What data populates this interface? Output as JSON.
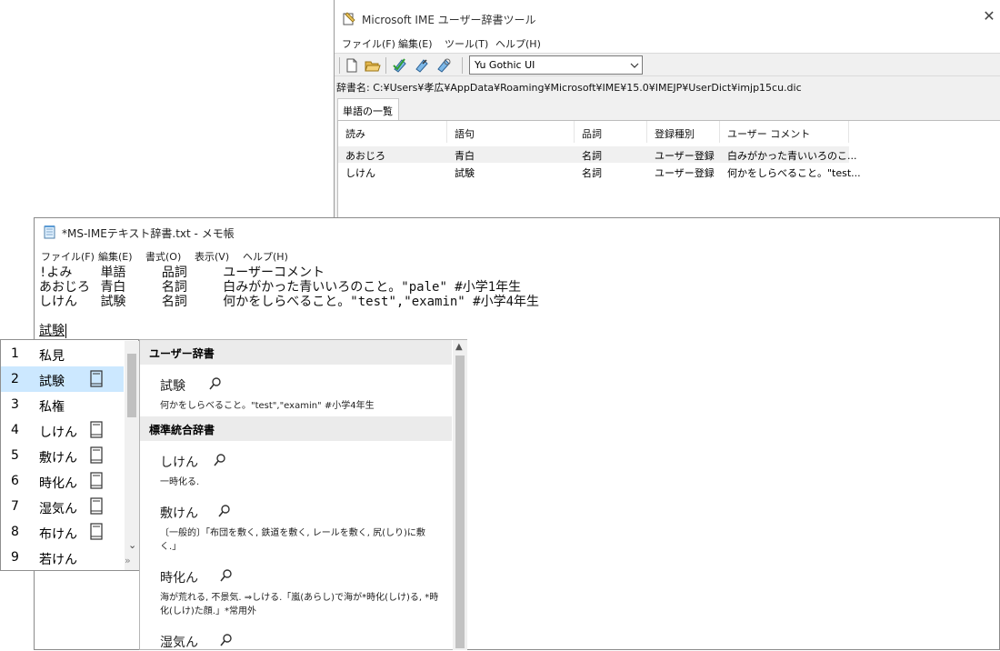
{
  "ime_tool": {
    "title": "Microsoft IME ユーザー辞書ツール",
    "menu": [
      "ファイル(F)",
      "編集(E)",
      "ツール(T)",
      "ヘルプ(H)"
    ],
    "font_select": "Yu Gothic UI",
    "dict_path": "辞書名: C:¥Users¥孝広¥AppData¥Roaming¥Microsoft¥IME¥15.0¥IMEJP¥UserDict¥imjp15cu.dic",
    "tab_label": "単語の一覧",
    "columns": [
      "読み",
      "語句",
      "品詞",
      "登録種別",
      "ユーザー コメント"
    ],
    "rows": [
      [
        "あおじろ",
        "青白",
        "名詞",
        "ユーザー登録",
        "白みがかった青いいろのこ..."
      ],
      [
        "しけん",
        "試験",
        "名詞",
        "ユーザー登録",
        "何かをしらべること。\"test..."
      ]
    ]
  },
  "notepad": {
    "title": "*MS-IMEテキスト辞書.txt - メモ帳",
    "menu": [
      "ファイル(F)",
      "編集(E)",
      "書式(O)",
      "表示(V)",
      "ヘルプ(H)"
    ],
    "lines": [
      "!よみ\t単語\t品詞\tユーザーコメント",
      "あおじろ\t青白\t名詞\t白みがかった青いいろのこと。\"pale\" #小学1年生",
      "しけん\t試験\t名詞\t何かをしらべること。\"test\",\"examin\" #小学4年生"
    ],
    "composing": "試験"
  },
  "candidates": [
    {
      "num": "1",
      "word": "私見",
      "book": false
    },
    {
      "num": "2",
      "word": "試験",
      "book": true,
      "selected": true
    },
    {
      "num": "3",
      "word": "私権",
      "book": false
    },
    {
      "num": "4",
      "word": "しけん",
      "book": true
    },
    {
      "num": "5",
      "word": "敷けん",
      "book": true
    },
    {
      "num": "6",
      "word": "時化ん",
      "book": true
    },
    {
      "num": "7",
      "word": "湿気ん",
      "book": true
    },
    {
      "num": "8",
      "word": "布けん",
      "book": true
    },
    {
      "num": "9",
      "word": "若けん",
      "book": false
    }
  ],
  "detail": {
    "user_header": "ユーザー辞書",
    "user_word": "試験",
    "user_desc": "何かをしらべること。\"test\",\"examin\" #小学4年生",
    "std_header": "標準統合辞書",
    "entries": [
      {
        "word": "しけん",
        "desc": "一時化る."
      },
      {
        "word": "敷けん",
        "desc": "〔一般的〕「布団を敷く, 鉄道を敷く, レールを敷く, 尻(しり)に敷く.」"
      },
      {
        "word": "時化ん",
        "desc": "海が荒れる, 不景気. ⇒しける.「嵐(あらし)で海が*時化(しけ)る, *時化(しけ)た顔.」*常用外"
      },
      {
        "word": "湿気ん",
        "desc": ""
      }
    ]
  },
  "colors": {
    "selection": "#cce8ff",
    "section_header": "#ebebeb"
  }
}
